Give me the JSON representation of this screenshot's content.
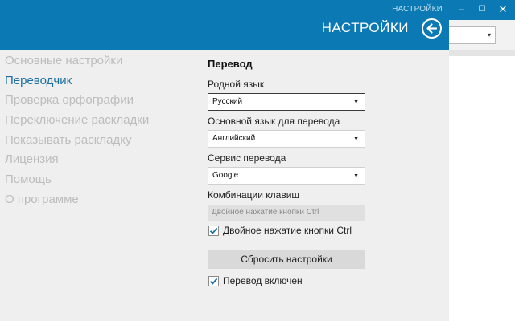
{
  "window": {
    "minimize_glyph": "–",
    "maximize_glyph": "☐",
    "close_glyph": "✕",
    "bg_dropdown_arrow": "▾"
  },
  "header": {
    "small_title": "НАСТРОЙКИ",
    "title": "НАСТРОЙКИ",
    "back_icon": "arrow-left-circle-icon"
  },
  "nav": {
    "items": [
      {
        "label": "Основные настройки",
        "active": false
      },
      {
        "label": "Переводчик",
        "active": true
      },
      {
        "label": "Проверка орфографии",
        "active": false
      },
      {
        "label": "Переключение раскладки",
        "active": false
      },
      {
        "label": "Показывать раскладку",
        "active": false
      },
      {
        "label": "Лицензия",
        "active": false
      },
      {
        "label": "Помощь",
        "active": false
      },
      {
        "label": "О программе",
        "active": false
      }
    ]
  },
  "translation": {
    "section_title": "Перевод",
    "native_language": {
      "label": "Родной язык",
      "value": "Русский"
    },
    "target_language": {
      "label": "Основной язык для перевода",
      "value": "Английский"
    },
    "service": {
      "label": "Сервис перевода",
      "value": "Google"
    },
    "hotkeys": {
      "label": "Комбинации клавиш",
      "value": "Двойное нажатие кнопки Ctrl"
    },
    "double_ctrl": {
      "label": "Двойное нажатие кнопки Ctrl",
      "checked": true
    },
    "reset_label": "Сбросить настройки",
    "enabled": {
      "label": "Перевод включен",
      "checked": true
    },
    "dropdown_arrow": "▼"
  },
  "colors": {
    "accent": "#0b79b3",
    "active_nav": "#1b6fa0",
    "panel_bg": "#efefef"
  }
}
